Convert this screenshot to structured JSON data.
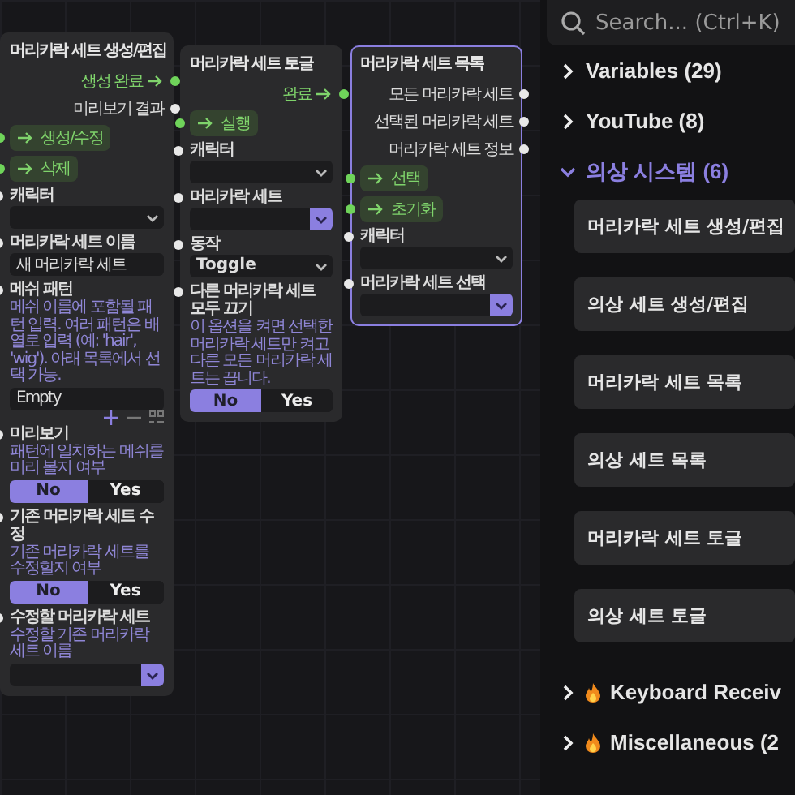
{
  "nodes": [
    {
      "title": "머리카락 세트 생성/편집",
      "selected": false,
      "outputs": [
        {
          "label": "생성 완료",
          "kind": "exec"
        },
        {
          "label": "미리보기 결과",
          "kind": "data"
        }
      ],
      "inputs": [
        {
          "label": "생성/수정",
          "kind": "exec"
        },
        {
          "label": "삭제",
          "kind": "exec"
        }
      ],
      "fields": [
        {
          "label": "캐릭터",
          "kind": "select",
          "accent": false
        },
        {
          "label": "머리카락 세트 이름",
          "kind": "text",
          "value": "새 머리카락 세트"
        },
        {
          "label": "메쉬 패턴",
          "description": "메쉬 이름에 포함될 패턴 입력. 여러 패턴은 배열로 입력 (예: 'hair', 'wig'). 아래 목록에서 선택 가능.",
          "kind": "list",
          "items": [
            "Empty"
          ]
        },
        {
          "label": "미리보기",
          "description": "패턴에 일치하는 메쉬를 미리 볼지 여부",
          "kind": "toggle",
          "options": [
            {
              "label": "No",
              "selected": true
            },
            {
              "label": "Yes",
              "selected": false
            }
          ]
        },
        {
          "label": "기존 머리카락 세트 수정",
          "description": "기존 머리카락 세트를 수정할지 여부",
          "kind": "toggle",
          "options": [
            {
              "label": "No",
              "selected": true
            },
            {
              "label": "Yes",
              "selected": false
            }
          ]
        },
        {
          "label": "수정할 머리카락 세트",
          "description": "수정할 기존 머리카락 세트 이름",
          "kind": "select",
          "accent": true
        }
      ]
    },
    {
      "title": "머리카락 세트 토글",
      "selected": false,
      "outputs": [
        {
          "label": "완료",
          "kind": "exec"
        }
      ],
      "inputs": [
        {
          "label": "실행",
          "kind": "exec"
        }
      ],
      "fields": [
        {
          "label": "캐릭터",
          "kind": "select",
          "accent": false
        },
        {
          "label": "머리카락 세트",
          "kind": "select",
          "accent": true
        },
        {
          "label": "동작",
          "kind": "select",
          "accent": false,
          "value": "Toggle"
        },
        {
          "label": "다른 머리카락 세트 모두 끄기",
          "description": "이 옵션을 켜면 선택한 머리카락 세트만 켜고 다른 모든 머리카락 세트는 끕니다.",
          "kind": "toggle",
          "options": [
            {
              "label": "No",
              "selected": true
            },
            {
              "label": "Yes",
              "selected": false
            }
          ]
        }
      ]
    },
    {
      "title": "머리카락 세트 목록",
      "selected": true,
      "outputs": [
        {
          "label": "모든 머리카락 세트",
          "kind": "data"
        },
        {
          "label": "선택된 머리카락 세트",
          "kind": "data"
        },
        {
          "label": "머리카락 세트 정보",
          "kind": "data"
        }
      ],
      "inputs": [
        {
          "label": "선택",
          "kind": "exec"
        },
        {
          "label": "초기화",
          "kind": "exec"
        }
      ],
      "fields": [
        {
          "label": "캐릭터",
          "kind": "select",
          "accent": false
        },
        {
          "label": "머리카락 세트 선택",
          "kind": "select",
          "accent": true
        }
      ]
    }
  ],
  "sidebar": {
    "search": {
      "placeholder": "Search... (Ctrl+K)"
    },
    "categories": [
      {
        "label": "Variables (29)",
        "expanded": false
      },
      {
        "label": "YouTube (8)",
        "expanded": false
      },
      {
        "label": "의상 시스템 (6)",
        "expanded": true,
        "children": [
          {
            "label": "머리카락 세트 생성/편집"
          },
          {
            "label": "의상 세트 생성/편집"
          },
          {
            "label": "머리카락 세트 목록"
          },
          {
            "label": "의상 세트 목록"
          },
          {
            "label": "머리카락 세트 토글"
          },
          {
            "label": "의상 세트 토글"
          }
        ]
      },
      {
        "label": "Keyboard Receiv",
        "expanded": false,
        "kind": "fire"
      },
      {
        "label": "Miscellaneous (2",
        "expanded": false,
        "kind": "fire"
      }
    ]
  }
}
